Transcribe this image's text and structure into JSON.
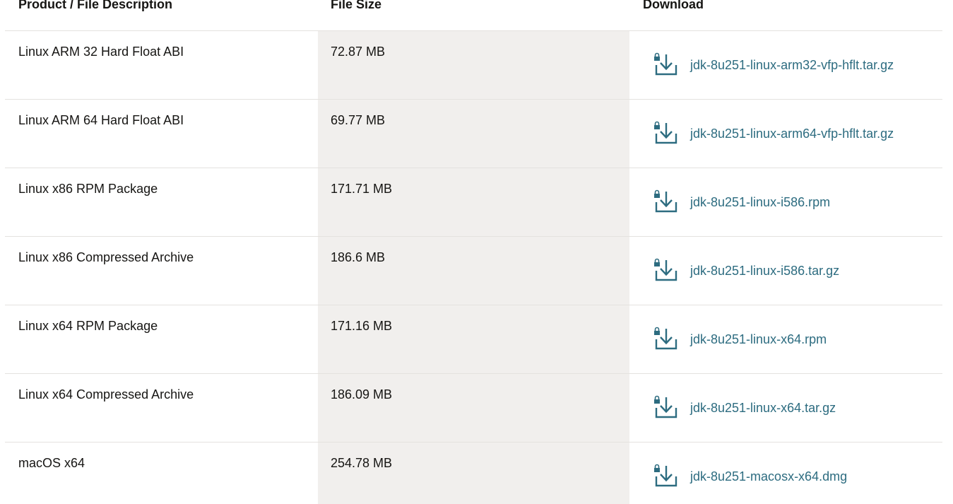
{
  "table": {
    "headers": {
      "description": "Product / File Description",
      "size": "File Size",
      "download": "Download"
    },
    "rows": [
      {
        "description": "Linux ARM 32 Hard Float ABI",
        "size": "72.87 MB",
        "file": "jdk-8u251-linux-arm32-vfp-hflt.tar.gz"
      },
      {
        "description": "Linux ARM 64 Hard Float ABI",
        "size": "69.77 MB",
        "file": "jdk-8u251-linux-arm64-vfp-hflt.tar.gz"
      },
      {
        "description": "Linux x86 RPM Package",
        "size": "171.71 MB",
        "file": "jdk-8u251-linux-i586.rpm"
      },
      {
        "description": "Linux x86 Compressed Archive",
        "size": "186.6 MB",
        "file": "jdk-8u251-linux-i586.tar.gz"
      },
      {
        "description": "Linux x64 RPM Package",
        "size": "171.16 MB",
        "file": "jdk-8u251-linux-x64.rpm"
      },
      {
        "description": "Linux x64 Compressed Archive",
        "size": "186.09 MB",
        "file": "jdk-8u251-linux-x64.tar.gz"
      },
      {
        "description": "macOS x64",
        "size": "254.78 MB",
        "file": "jdk-8u251-macosx-x64.dmg"
      }
    ]
  },
  "icons": {
    "download": "download-lock-icon"
  },
  "colors": {
    "link": "#2d6c80",
    "size_column_bg": "#f1efed",
    "divider": "#e4e2df"
  }
}
